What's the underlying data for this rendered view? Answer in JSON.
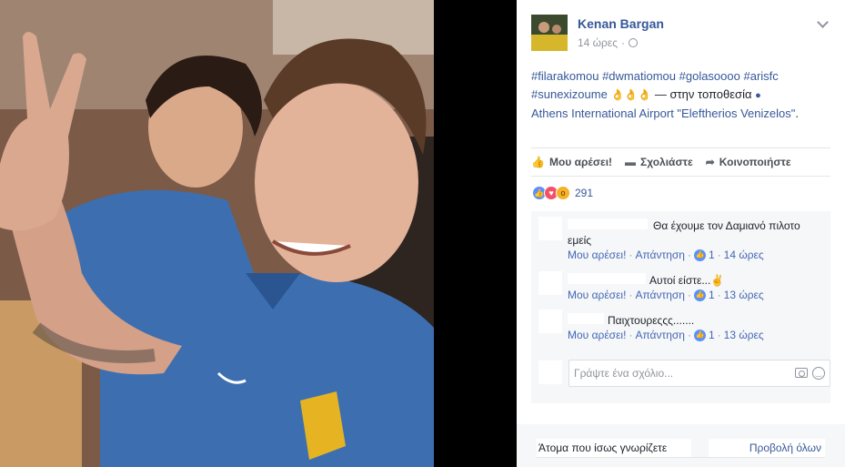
{
  "post": {
    "author": "Kenan Bargan",
    "time": "14 ώρες",
    "hashtags_line1": [
      "#filarakomou",
      "#dwmatiomou",
      "#golasoooo",
      "#arisfc"
    ],
    "hashtag_line2": "#sunexizoume",
    "emoji": "👌👌👌",
    "location_prefix": "— στην τοποθεσία",
    "location": "Athens International Airport \"Eleftherios Venizelos\"",
    "location_end": "."
  },
  "actions": {
    "like": "Μου αρέσει!",
    "comment": "Σχολιάστε",
    "share": "Κοινοποιήστε"
  },
  "reactions": {
    "count": "291"
  },
  "comments": [
    {
      "text": "Θα έχουμε τον Δαμιανό πιλοτο",
      "text2": "εμείς",
      "like": "Μου αρέσει!",
      "reply": "Απάντηση",
      "likes": "1",
      "time": "14 ώρες"
    },
    {
      "text": "Αυτοί είστε...✌",
      "like": "Μου αρέσει!",
      "reply": "Απάντηση",
      "likes": "1",
      "time": "13 ώρες"
    },
    {
      "text": "Παιχτουρεςςς.......",
      "like": "Μου αρέσει!",
      "reply": "Απάντηση",
      "likes": "1",
      "time": "13 ώρες"
    }
  ],
  "comment_input": {
    "placeholder": "Γράψτε ένα σχόλιο..."
  },
  "footer": {
    "people": "Άτομα που ίσως γνωρίζετε",
    "see_all": "Προβολή όλων"
  },
  "colors": {
    "link": "#365899",
    "shirt": "#3d6fb0",
    "photo_bg": "#000000"
  }
}
